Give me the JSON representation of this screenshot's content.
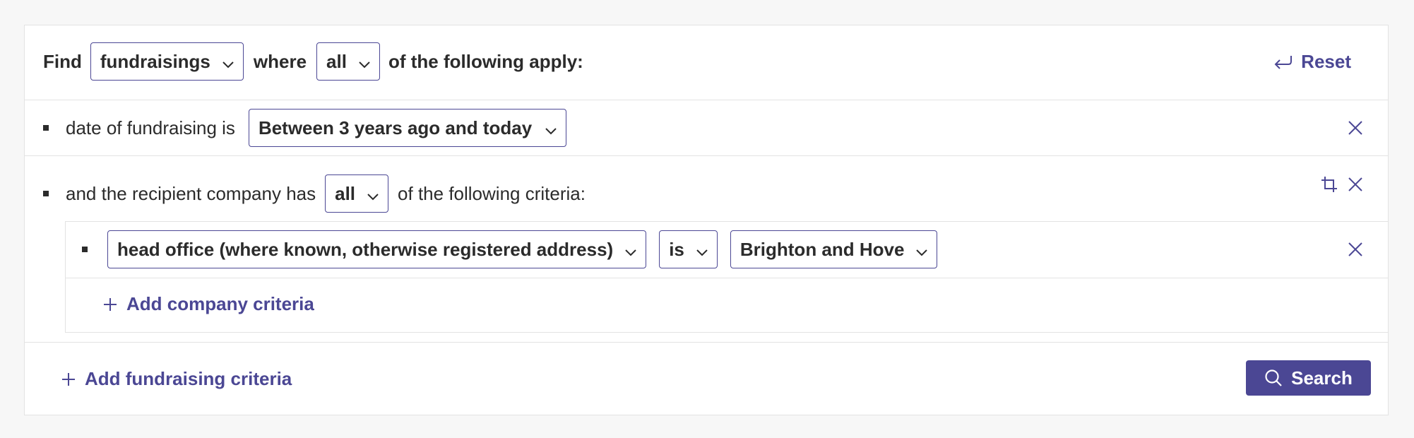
{
  "header": {
    "find_label": "Find",
    "entity_value": "fundraisings",
    "where_label": "where",
    "match_value": "all",
    "following_label": "of the following apply:",
    "reset_label": "Reset"
  },
  "criteria": [
    {
      "prefix": "date of fundraising is",
      "value": "Between 3 years ago and today"
    },
    {
      "prefix": "and the recipient company has",
      "match_value": "all",
      "suffix": "of the following criteria:",
      "nested": [
        {
          "field": "head office (where known, otherwise registered address)",
          "operator": "is",
          "value": "Brighton and Hove"
        }
      ],
      "add_label": "Add company criteria"
    }
  ],
  "footer": {
    "add_label": "Add fundraising criteria",
    "search_label": "Search"
  },
  "colors": {
    "accent": "#4b4794",
    "border": "#e3e3e3",
    "text": "#2b2b2b"
  },
  "icons": [
    "chevron-down-icon",
    "undo-arrow-icon",
    "close-icon",
    "crop-icon",
    "plus-icon",
    "search-icon"
  ]
}
